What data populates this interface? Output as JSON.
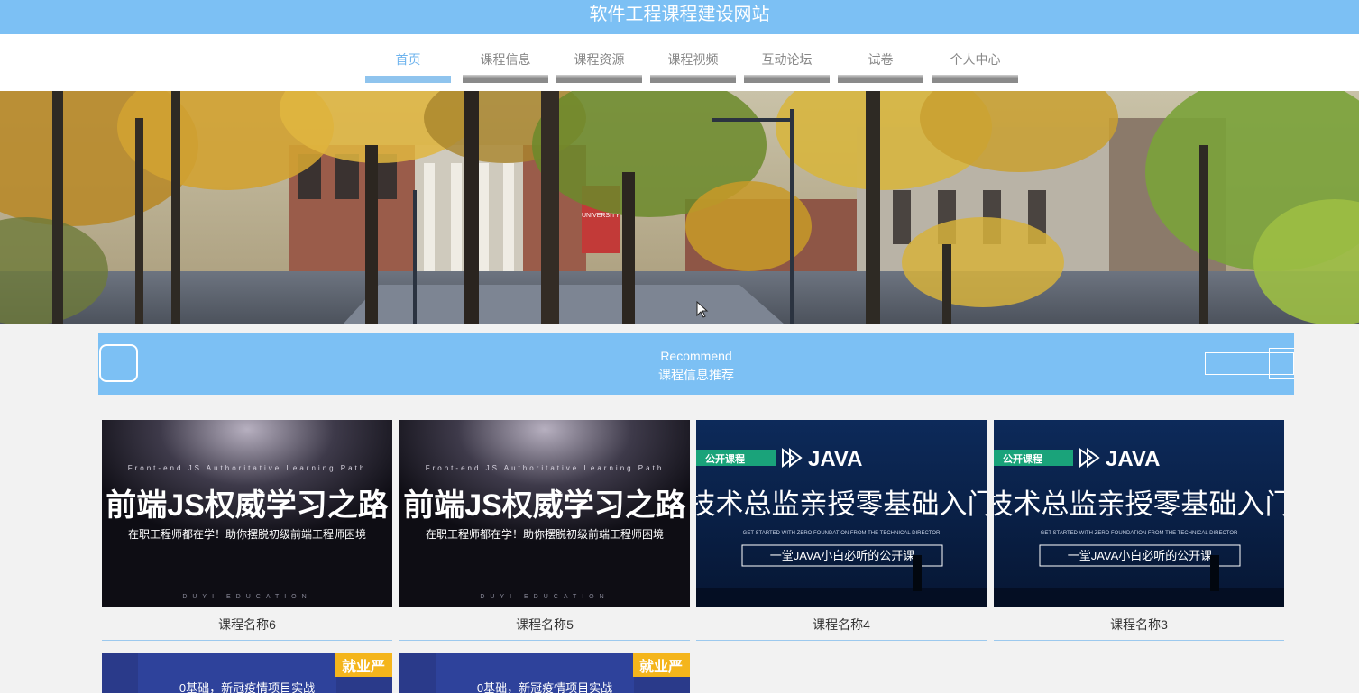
{
  "site": {
    "title": "软件工程课程建设网站"
  },
  "nav": {
    "items": [
      {
        "label": "首页",
        "active": true
      },
      {
        "label": "课程信息"
      },
      {
        "label": "课程资源"
      },
      {
        "label": "课程视频"
      },
      {
        "label": "互动论坛"
      },
      {
        "label": "试卷"
      },
      {
        "label": "个人中心"
      }
    ]
  },
  "banner": {
    "banner_sign": "UNIVERSITY"
  },
  "recommend": {
    "en": "Recommend",
    "cn": "课程信息推荐"
  },
  "courses": [
    {
      "name": "课程名称6",
      "thumb": {
        "kicker": "Front-end JS Authoritative Learning Path",
        "headline": "前端JS权威学习之路",
        "subtitle": "在职工程师都在学！助你摆脱初级前端工程师困境",
        "footer": "DUYI EDUCATION"
      }
    },
    {
      "name": "课程名称5",
      "thumb": {
        "kicker": "Front-end JS Authoritative Learning Path",
        "headline": "前端JS权威学习之路",
        "subtitle": "在职工程师都在学！助你摆脱初级前端工程师困境",
        "footer": "DUYI EDUCATION"
      }
    },
    {
      "name": "课程名称4",
      "thumb": {
        "tag": "公开课程",
        "brand": "JAVA",
        "headline": "技术总监亲授零基础入门",
        "english": "GET STARTED WITH ZERO FOUNDATION FROM THE TECHNICAL DIRECTOR",
        "box": "一堂JAVA小白必听的公开课"
      }
    },
    {
      "name": "课程名称3",
      "thumb": {
        "tag": "公开课程",
        "brand": "JAVA",
        "headline": "技术总监亲授零基础入门",
        "english": "GET STARTED WITH ZERO FOUNDATION FROM THE TECHNICAL DIRECTOR",
        "box": "一堂JAVA小白必听的公开课"
      }
    }
  ],
  "more_courses": [
    {
      "badge": "就业严",
      "line": "0基础，新冠疫情项目实战"
    },
    {
      "badge": "就业严",
      "line": "0基础，新冠疫情项目实战"
    }
  ]
}
